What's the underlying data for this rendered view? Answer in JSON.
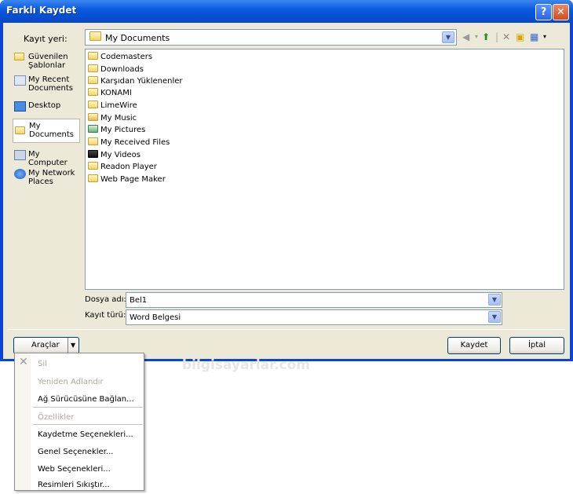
{
  "window": {
    "title": "Farklı Kaydet",
    "help_label": "?",
    "close_label": "✕"
  },
  "save_in": {
    "label": "Kayıt yeri:",
    "value": "My Documents"
  },
  "places": [
    {
      "label": "Güvenilen Şablonlar",
      "icon": "folder-icon"
    },
    {
      "label": "My Recent Documents",
      "icon": "recent-documents-icon"
    },
    {
      "label": "Desktop",
      "icon": "desktop-icon"
    },
    {
      "label": "My Documents",
      "icon": "my-documents-icon",
      "selected": true
    },
    {
      "label": "My Computer",
      "icon": "computer-icon"
    },
    {
      "label": "My Network Places",
      "icon": "network-places-icon"
    }
  ],
  "files": [
    "Codemasters",
    "Downloads",
    "Karşıdan Yüklenenler",
    "KONAMI",
    "LimeWire",
    "My Music",
    "My Pictures",
    "My Received Files",
    "My Videos",
    "Readon Player",
    "Web Page Maker"
  ],
  "file_name": {
    "label": "Dosya adı:",
    "value": "Bel1"
  },
  "file_type": {
    "label": "Kayıt türü:",
    "value": "Word Belgesi"
  },
  "buttons": {
    "tools": "Araçlar",
    "save": "Kaydet",
    "cancel": "İptal"
  },
  "tools_menu": [
    {
      "label": "Sil",
      "disabled": true
    },
    {
      "label": "Yeniden Adlandır",
      "disabled": true
    },
    {
      "label": "Ağ Sürücüsüne Bağlan...",
      "disabled": false
    },
    {
      "label": "Özellikler",
      "disabled": true
    },
    {
      "label": "Kaydetme Seçenekleri...",
      "disabled": false
    },
    {
      "label": "Genel Seçenekler...",
      "disabled": false
    },
    {
      "label": "Web Seçenekleri...",
      "disabled": false
    },
    {
      "label": "Resimleri Sıkıştır...",
      "disabled": false
    }
  ],
  "watermark": "bilgisayarlar.com"
}
